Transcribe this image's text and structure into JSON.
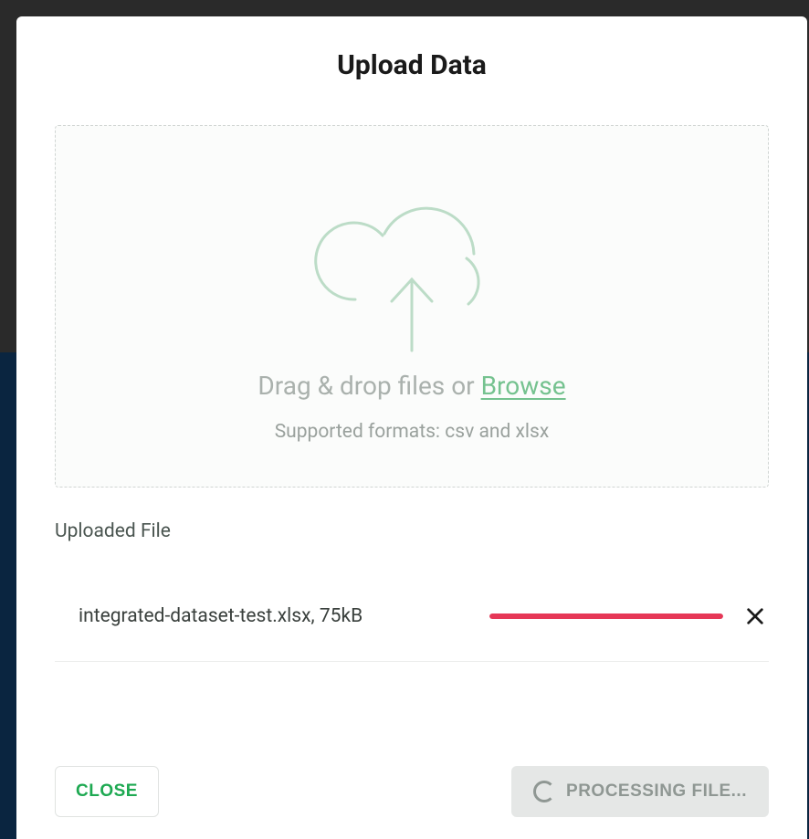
{
  "modal": {
    "title": "Upload Data",
    "dropzone": {
      "prompt_prefix": "Drag & drop files or ",
      "browse_label": "Browse",
      "supported_text": "Supported formats: csv and xlsx"
    },
    "uploaded_section": {
      "label": "Uploaded File",
      "files": [
        {
          "display": "integrated-dataset-test.xlsx, 75kB",
          "progress_percent": 100,
          "progress_color": "#e63757"
        }
      ]
    },
    "footer": {
      "close_label": "CLOSE",
      "processing_label": "PROCESSING FILE..."
    }
  }
}
